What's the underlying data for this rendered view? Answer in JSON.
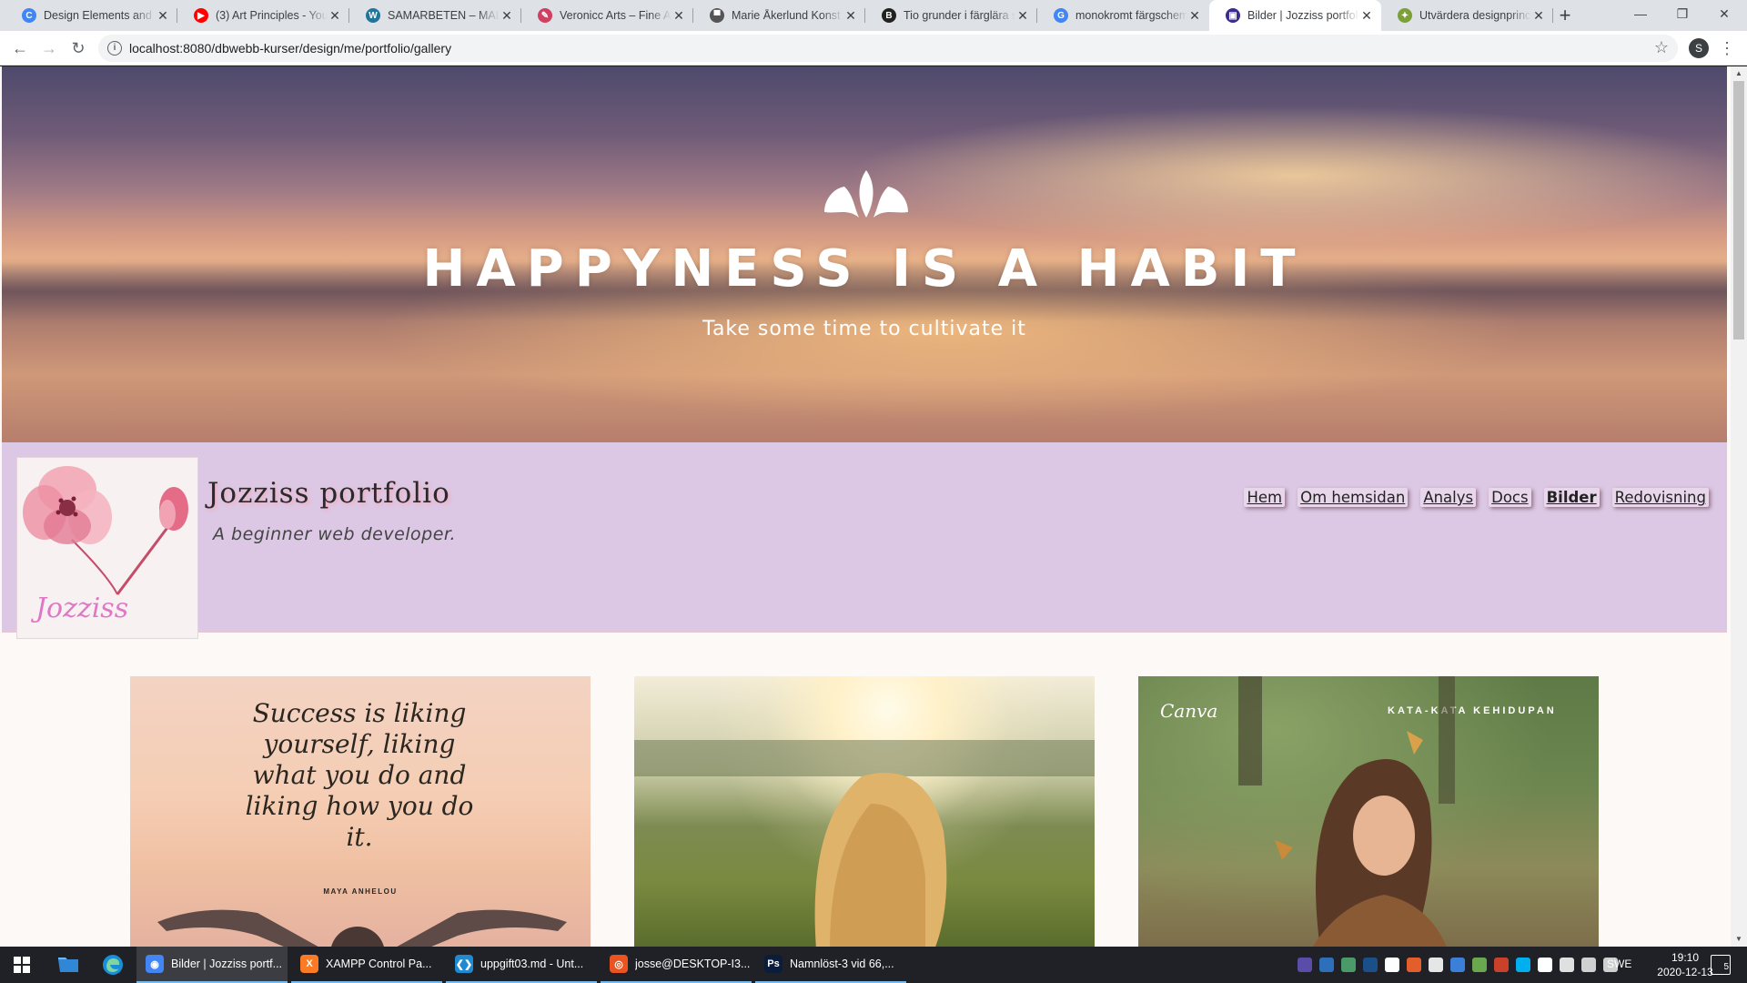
{
  "browser": {
    "tabs": [
      {
        "label": "Design Elements and Principles",
        "favicon": "c-logo-icon",
        "color": "#4285f4",
        "glyph": "C"
      },
      {
        "label": "(3) Art Principles - YouTube",
        "favicon": "youtube-icon",
        "color": "#ff0000",
        "glyph": "▶"
      },
      {
        "label": "SAMARBETEN – MALIN",
        "favicon": "wordpress-icon",
        "color": "#21759b",
        "glyph": "W"
      },
      {
        "label": "Veronicc Arts – Fine Art",
        "favicon": "brush-icon",
        "color": "#d04060",
        "glyph": "✎"
      },
      {
        "label": "Marie Åkerlund Konst K",
        "favicon": "painting-icon",
        "color": "#555555",
        "glyph": "▀"
      },
      {
        "label": "Tio grunder i färglära s",
        "favicon": "b-logo-icon",
        "color": "#222222",
        "glyph": "B"
      },
      {
        "label": "monokromt färgschema",
        "favicon": "google-icon",
        "color": "#4285f4",
        "glyph": "G"
      },
      {
        "label": "Bilder | Jozziss portfolio",
        "favicon": "portfolio-icon",
        "color": "#3a2b8f",
        "glyph": "▣",
        "active": true
      },
      {
        "label": "Utvärdera designprinciper",
        "favicon": "leaf-icon",
        "color": "#7ba037",
        "glyph": "✦"
      }
    ],
    "url": "localhost:8080/dbwebb-kurser/design/me/portfolio/gallery",
    "profile_initial": "S"
  },
  "page": {
    "hero": {
      "title": "HAPPYNESS IS A HABIT",
      "subtitle": "Take some time to cultivate it"
    },
    "header": {
      "site_title": "Jozziss portfolio",
      "tagline": "A beginner web developer.",
      "logo_text": "Jozziss"
    },
    "nav": [
      {
        "label": "Hem",
        "active": false
      },
      {
        "label": "Om hemsidan",
        "active": false
      },
      {
        "label": "Analys",
        "active": false
      },
      {
        "label": "Docs",
        "active": false
      },
      {
        "label": "Bilder",
        "active": true
      },
      {
        "label": "Redovisning",
        "active": false
      }
    ],
    "gallery": {
      "card1": {
        "quote": "Success is liking yourself, liking what you do and liking how you do it.",
        "author": "MAYA ANHELOU"
      },
      "card3": {
        "brand": "Canva",
        "caption": "KATA-KATA KEHIDUPAN"
      }
    }
  },
  "taskbar": {
    "apps": [
      {
        "label": "Bilder | Jozziss portf...",
        "icon": "chrome-icon",
        "color": "#4285f4",
        "glyph": "◉",
        "active": true
      },
      {
        "label": "XAMPP Control Pa...",
        "icon": "xampp-icon",
        "color": "#fb7a24",
        "glyph": "X",
        "active": false
      },
      {
        "label": "uppgift03.md - Unt...",
        "icon": "vscode-icon",
        "color": "#1f8ad2",
        "glyph": "❮❯",
        "active": false
      },
      {
        "label": "josse@DESKTOP-I3...",
        "icon": "ubuntu-icon",
        "color": "#e95420",
        "glyph": "◎",
        "active": false
      },
      {
        "label": "Namnlöst-3 vid 66,...",
        "icon": "photoshop-icon",
        "color": "#0a1e3c",
        "glyph": "Ps",
        "active": false
      }
    ],
    "language": "SWE",
    "time": "19:10",
    "date": "2020-12-13",
    "notifications": "5"
  },
  "colors": {
    "header_bg": "#dcc8e4",
    "page_bg": "#fdf9f7",
    "title_shadow": "#f3a9bd"
  }
}
